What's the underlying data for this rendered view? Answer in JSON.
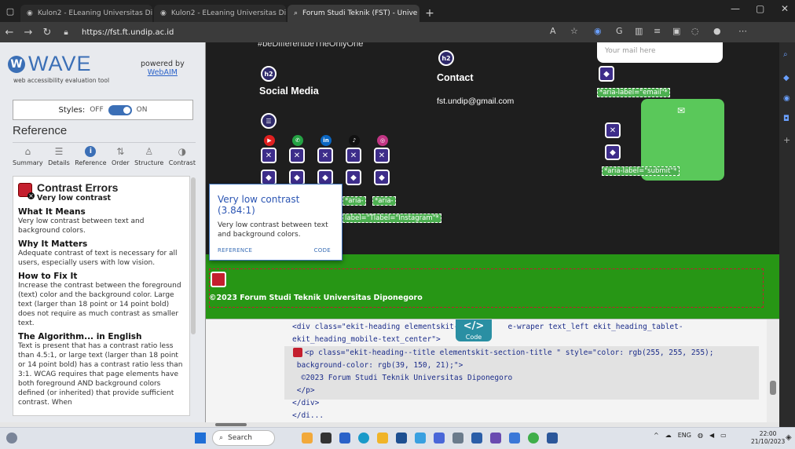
{
  "browser": {
    "tabs": [
      {
        "title": "Kulon2 - ELeaning Universitas Di",
        "active": false
      },
      {
        "title": "Kulon2 - ELeaning Universitas Di",
        "active": false
      },
      {
        "title": "Forum Studi Teknik (FST) - Unive",
        "active": true
      }
    ],
    "url": "https://fst.ft.undip.ac.id"
  },
  "wave": {
    "brand": "WAVE",
    "subtitle": "web accessibility evaluation tool",
    "powered_by": "powered by",
    "powered_link": "WebAIM",
    "styles_label": "Styles:",
    "styles_off": "OFF",
    "styles_on": "ON",
    "section_title": "Reference",
    "tabs": [
      {
        "label": "Summary",
        "icon": "home-icon"
      },
      {
        "label": "Details",
        "icon": "list-icon"
      },
      {
        "label": "Reference",
        "icon": "info-icon"
      },
      {
        "label": "Order",
        "icon": "order-icon"
      },
      {
        "label": "Structure",
        "icon": "structure-icon"
      },
      {
        "label": "Contrast",
        "icon": "contrast-icon"
      }
    ],
    "panel": {
      "title": "Contrast Errors",
      "subtitle": "Very low contrast",
      "sections": [
        {
          "heading": "What It Means",
          "text": "Very low contrast between text and background colors."
        },
        {
          "heading": "Why It Matters",
          "text": "Adequate contrast of text is necessary for all users, especially users with low vision."
        },
        {
          "heading": "How to Fix It",
          "text": "Increase the contrast between the foreground (text) color and the background color. Large text (larger than 18 point or 14 point bold) does not require as much contrast as smaller text."
        },
        {
          "heading": "The Algorithm... in English",
          "text": "Text is present that has a contrast ratio less than 4.5:1, or large text (larger than 18 point or 14 point bold) has a contrast ratio less than 3:1. WCAG requires that page elements have both foreground AND background colors defined (or inherited) that provide sufficient contrast. When"
        }
      ]
    }
  },
  "page": {
    "partial_heading": "#beDifferentbeTheOnlyOne",
    "social_title": "Social Media",
    "contact_title": "Contact",
    "contact_email": "fst.undip@gmail.com",
    "email_placeholder": "Your mail here",
    "h2_badge": "h2",
    "aria_email": "*aria-label=\"email\"*",
    "aria_submit": "*aria-label=\"submit\"*",
    "aria_short_1": "*aria-",
    "aria_short_2": "*aria-",
    "aria_instagram": "label=\"Tlabel=\"Instagram\"*",
    "tooltip": {
      "title": "Very low contrast (3.84:1)",
      "text": "Very low contrast between text and background colors.",
      "reference": "REFERENCE",
      "code": "CODE"
    },
    "footer_text": "©2023 Forum Studi Teknik Universitas Diponegoro"
  },
  "code_panel": {
    "button_glyph": "</>",
    "button_label": "Code",
    "lines": [
      "<div class=\"ekit-heading elementskit-se         e-wraper text_left ekit_heading_tablet-",
      "ekit_heading_mobile-text_center\">",
      "<p class=\"ekit-heading--title elementskit-section-title \" style=\"color: rgb(255, 255, 255);",
      " background-color: rgb(39, 150, 21);\">",
      "  ©2023 Forum Studi Teknik Universitas Diponegoro",
      " </p>",
      "</div>",
      "</di..."
    ]
  },
  "taskbar": {
    "search": "Search",
    "lang": "ENG",
    "time": "22:00",
    "date": "21/10/2023"
  },
  "colors": {
    "wave_blue": "#3b6fb6",
    "error_red": "#c41f2e",
    "footer_green": "#279615",
    "code_teal": "#2a8fa3"
  }
}
